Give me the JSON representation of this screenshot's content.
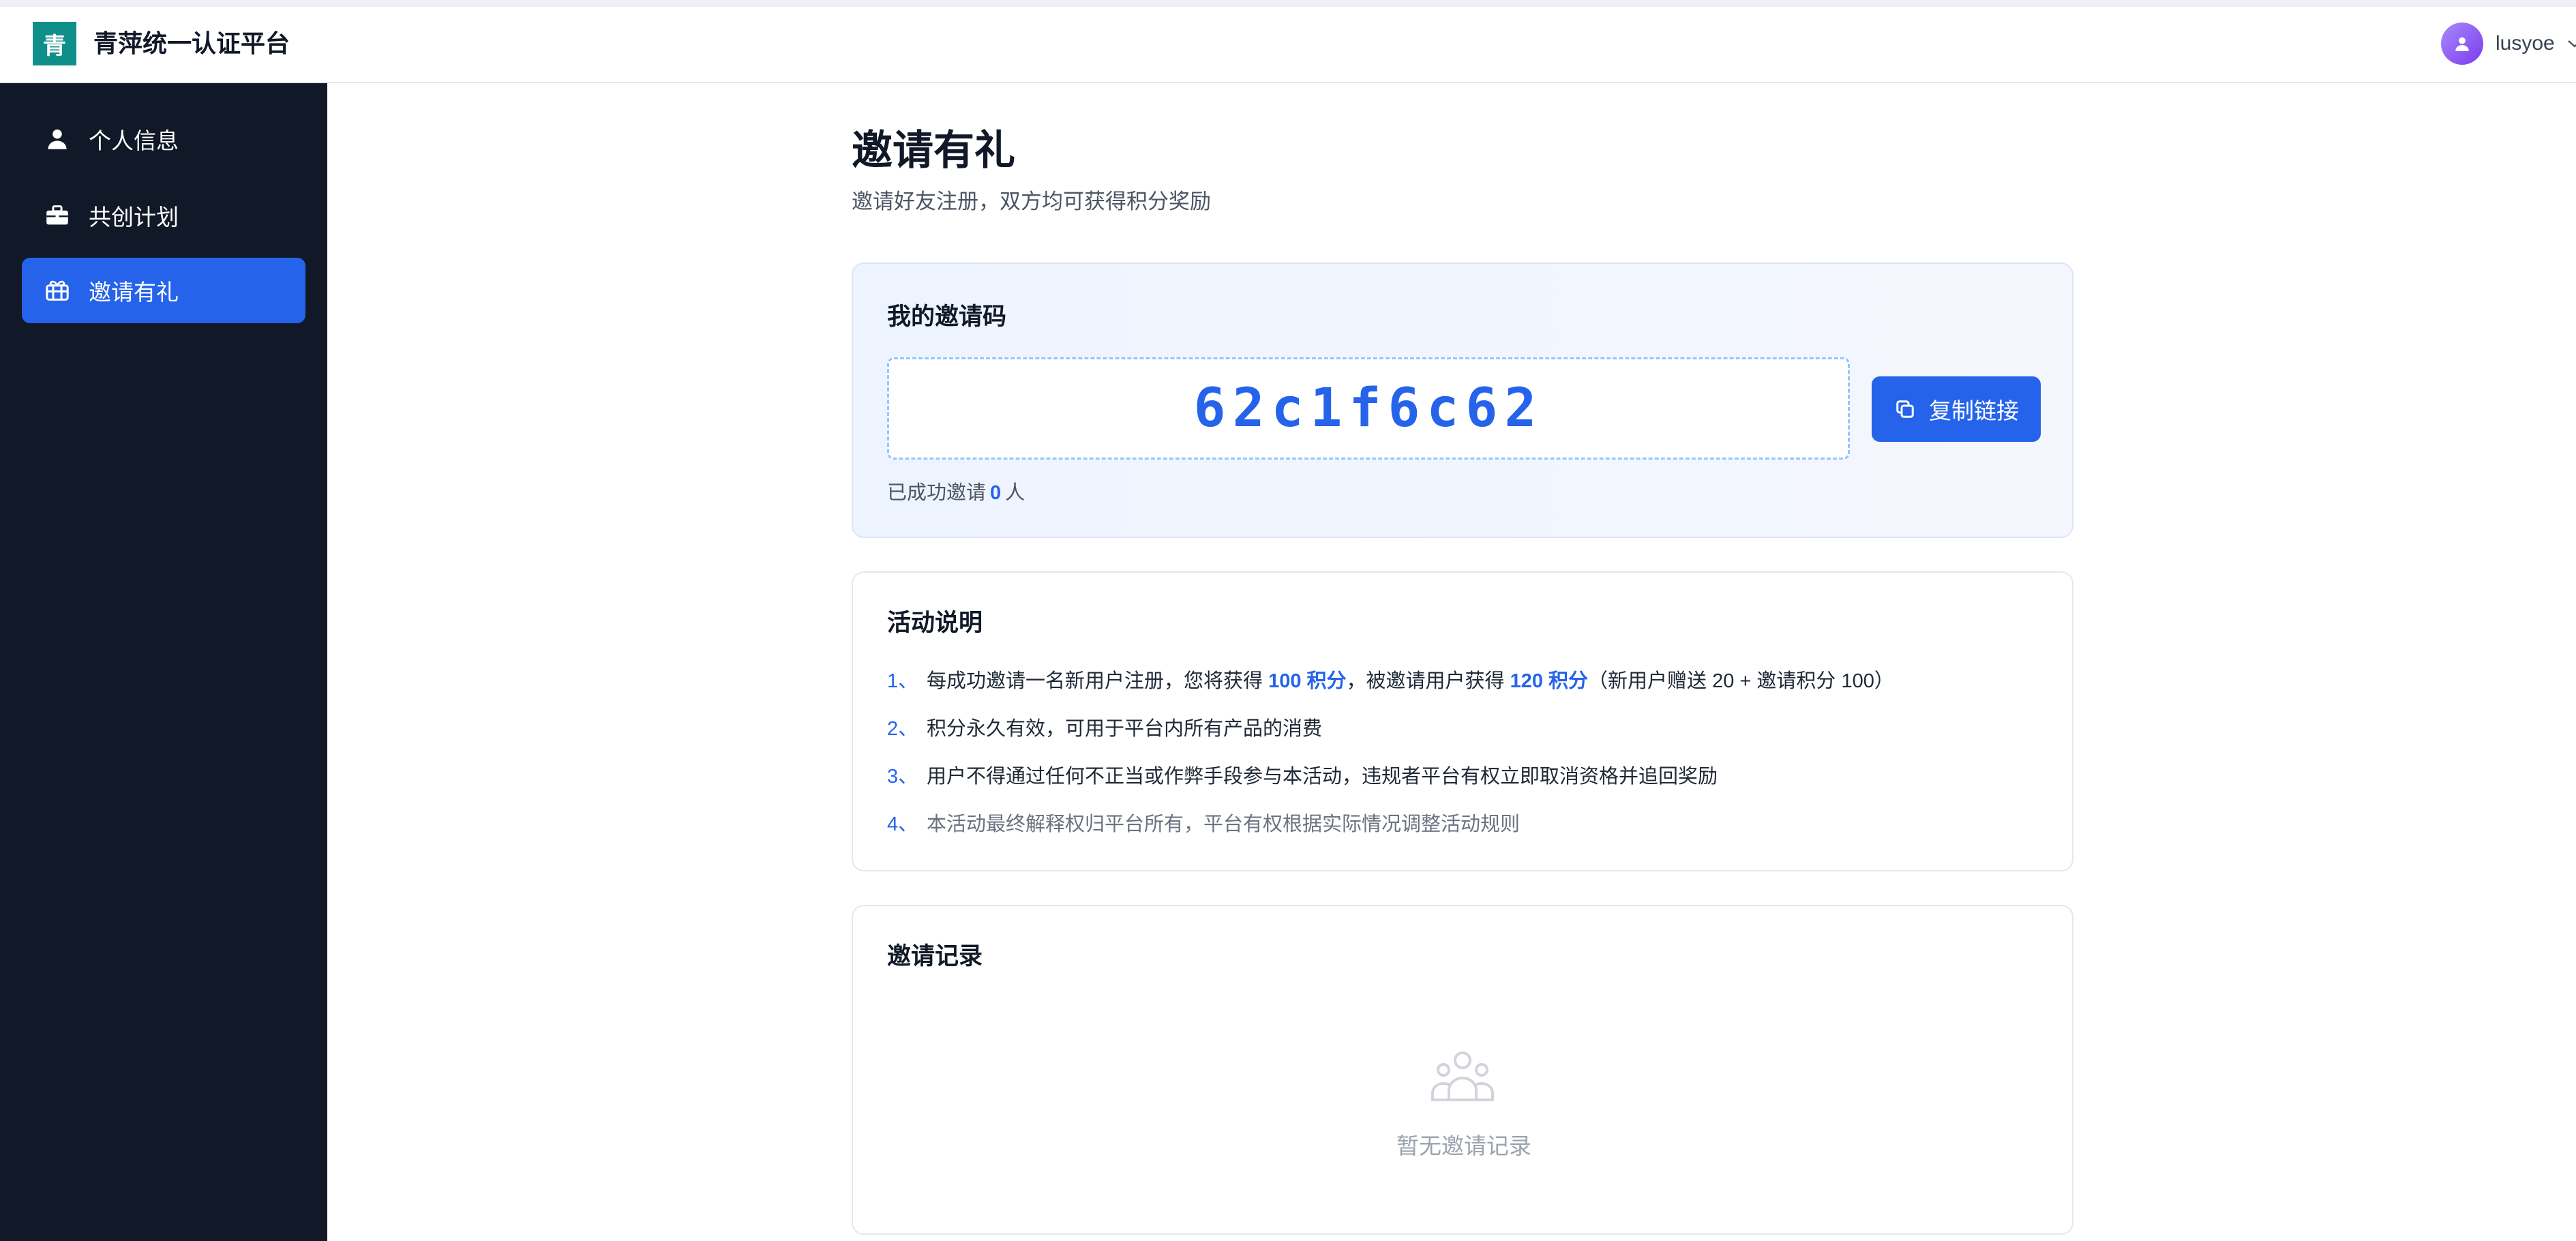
{
  "header": {
    "logo_char": "青",
    "title": "青萍统一认证平台",
    "username": "lusyoe"
  },
  "sidebar": {
    "items": [
      {
        "label": "个人信息",
        "icon": "user-icon",
        "active": false
      },
      {
        "label": "共创计划",
        "icon": "briefcase-icon",
        "active": false
      },
      {
        "label": "邀请有礼",
        "icon": "gift-icon",
        "active": true
      }
    ]
  },
  "main": {
    "title": "邀请有礼",
    "subtitle": "邀请好友注册，双方均可获得积分奖励",
    "invite": {
      "heading": "我的邀请码",
      "code": "62c1f6c62",
      "copy_label": "复制链接",
      "invited_prefix": "已成功邀请",
      "invited_count": "0",
      "invited_suffix": "人"
    },
    "rules": {
      "heading": "活动说明",
      "items": [
        {
          "num": "1、",
          "a": "每成功邀请一名新用户注册，您将获得 ",
          "b": "100 积分",
          "c": "，被邀请用户获得 ",
          "d": "120 积分",
          "e": "（新用户赠送 20 + 邀请积分 100）"
        },
        {
          "num": "2、",
          "text": "积分永久有效，可用于平台内所有产品的消费"
        },
        {
          "num": "3、",
          "text": "用户不得通过任何不正当或作弊手段参与本活动，违规者平台有权立即取消资格并追回奖励"
        },
        {
          "num": "4、",
          "text": "本活动最终解释权归平台所有，平台有权根据实际情况调整活动规则"
        }
      ]
    },
    "records": {
      "heading": "邀请记录",
      "empty_text": "暂无邀请记录",
      "empty_icon": "users-icon"
    }
  },
  "colors": {
    "accent": "#2563eb",
    "sidebar_bg": "#111827",
    "logo_bg": "#0f8f8a"
  }
}
